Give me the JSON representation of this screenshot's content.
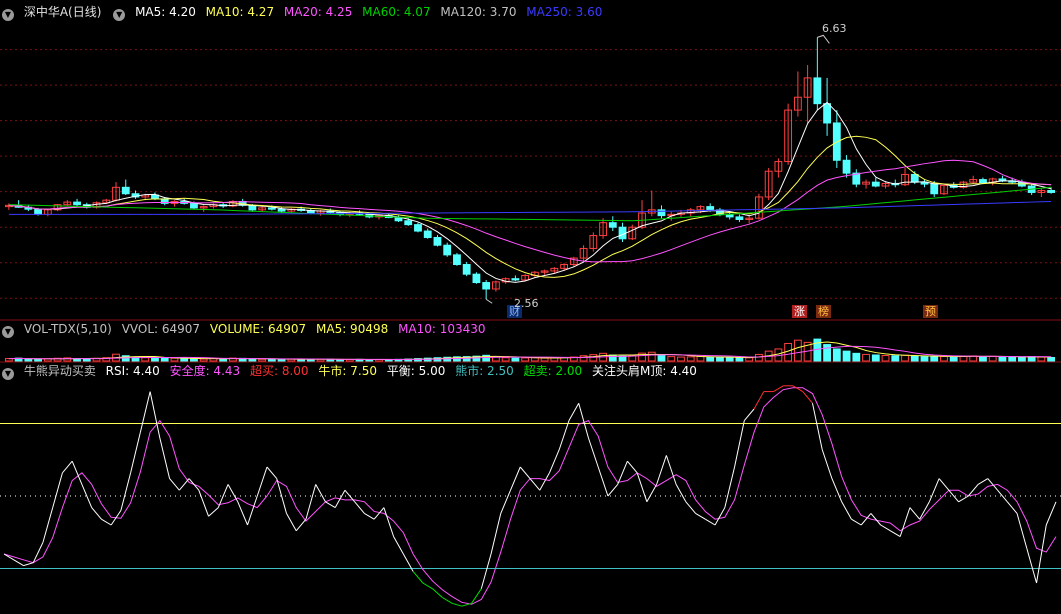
{
  "colors": {
    "bg": "#000000",
    "up": "#ff4040",
    "down": "#54ffff",
    "grid": "#7a1010",
    "ma5": "#ffffff",
    "ma10": "#ffff54",
    "ma20": "#ff54ff",
    "ma60": "#00d000",
    "ma120": "#a0a0a0",
    "ma250": "#3a3aff"
  },
  "price_panel": {
    "stock_name": "深中华A(日线)",
    "ma_labels": [
      {
        "text": "MA5: 4.20",
        "color": "#ffffff"
      },
      {
        "text": "MA10: 4.27",
        "color": "#ffff54"
      },
      {
        "text": "MA20: 4.25",
        "color": "#ff54ff"
      },
      {
        "text": "MA60: 4.07",
        "color": "#00d000"
      },
      {
        "text": "MA120: 3.70",
        "color": "#c0c0c0"
      },
      {
        "text": "MA250: 3.60",
        "color": "#3a3aff"
      }
    ],
    "high_label": "6.63",
    "low_label": "2.56",
    "markers": [
      {
        "text": "财",
        "color": "#8ab4ff",
        "bg": "#0a2a6a"
      },
      {
        "text": "涨",
        "color": "#ffffff",
        "bg": "#b02020"
      },
      {
        "text": "榜",
        "color": "#ffc040",
        "bg": "#7a2a10"
      },
      {
        "text": "预",
        "color": "#ffc040",
        "bg": "#7a2a10"
      }
    ]
  },
  "volume_panel": {
    "labels": [
      {
        "text": "VOL-TDX(5,10)",
        "color": "#c0c0c0"
      },
      {
        "text": "VVOL: 64907",
        "color": "#c0c0c0"
      },
      {
        "text": "VOLUME: 64907",
        "color": "#ffff54"
      },
      {
        "text": "MA5: 90498",
        "color": "#ffff54"
      },
      {
        "text": "MA10: 103430",
        "color": "#ff54ff"
      }
    ]
  },
  "rsi_panel": {
    "labels": [
      {
        "text": "牛熊异动买卖",
        "color": "#c0c0c0"
      },
      {
        "text": "RSI: 4.40",
        "color": "#ffffff"
      },
      {
        "text": "安全度: 4.43",
        "color": "#ff54ff"
      },
      {
        "text": "超买: 8.00",
        "color": "#ff3030"
      },
      {
        "text": "牛市: 7.50",
        "color": "#ffff54"
      },
      {
        "text": "平衡: 5.00",
        "color": "#ffffff"
      },
      {
        "text": "熊市: 2.50",
        "color": "#40c0c0"
      },
      {
        "text": "超卖: 2.00",
        "color": "#00e000"
      },
      {
        "text": "关注头肩M顶: 4.40",
        "color": "#ffffff"
      }
    ]
  },
  "chart_data": [
    {
      "type": "candlestick",
      "ylim": [
        2.3,
        6.9
      ],
      "ohlc": [
        [
          4.0,
          4.05,
          3.95,
          4.02
        ],
        [
          4.02,
          4.1,
          3.98,
          3.99
        ],
        [
          3.99,
          4.03,
          3.93,
          3.96
        ],
        [
          3.96,
          3.98,
          3.86,
          3.88
        ],
        [
          3.88,
          3.97,
          3.85,
          3.95
        ],
        [
          3.95,
          4.04,
          3.93,
          4.03
        ],
        [
          4.03,
          4.1,
          4.0,
          4.07
        ],
        [
          4.07,
          4.12,
          4.01,
          4.03
        ],
        [
          4.03,
          4.06,
          3.97,
          3.99
        ],
        [
          3.99,
          4.08,
          3.97,
          4.06
        ],
        [
          4.06,
          4.12,
          4.04,
          4.1
        ],
        [
          4.1,
          4.38,
          4.08,
          4.3
        ],
        [
          4.3,
          4.42,
          4.18,
          4.2
        ],
        [
          4.2,
          4.25,
          4.12,
          4.15
        ],
        [
          4.15,
          4.2,
          4.1,
          4.18
        ],
        [
          4.18,
          4.22,
          4.1,
          4.12
        ],
        [
          4.12,
          4.15,
          4.02,
          4.05
        ],
        [
          4.05,
          4.1,
          4.0,
          4.08
        ],
        [
          4.08,
          4.12,
          4.03,
          4.05
        ],
        [
          4.05,
          4.08,
          3.96,
          3.98
        ],
        [
          3.98,
          4.02,
          3.92,
          4.0
        ],
        [
          4.0,
          4.05,
          3.97,
          4.03
        ],
        [
          4.03,
          4.06,
          3.98,
          4.01
        ],
        [
          4.01,
          4.1,
          3.99,
          4.08
        ],
        [
          4.08,
          4.12,
          4.0,
          4.02
        ],
        [
          4.02,
          4.04,
          3.92,
          3.95
        ],
        [
          3.95,
          4.0,
          3.92,
          3.98
        ],
        [
          3.98,
          4.02,
          3.94,
          3.96
        ],
        [
          3.96,
          3.99,
          3.9,
          3.93
        ],
        [
          3.93,
          3.98,
          3.9,
          3.96
        ],
        [
          3.96,
          4.0,
          3.92,
          3.94
        ],
        [
          3.94,
          3.97,
          3.88,
          3.9
        ],
        [
          3.9,
          3.95,
          3.86,
          3.93
        ],
        [
          3.93,
          3.97,
          3.89,
          3.91
        ],
        [
          3.91,
          3.94,
          3.85,
          3.88
        ],
        [
          3.88,
          3.92,
          3.84,
          3.9
        ],
        [
          3.9,
          3.94,
          3.86,
          3.88
        ],
        [
          3.88,
          3.91,
          3.82,
          3.84
        ],
        [
          3.84,
          3.88,
          3.8,
          3.86
        ],
        [
          3.86,
          3.9,
          3.82,
          3.83
        ],
        [
          3.83,
          3.86,
          3.76,
          3.78
        ],
        [
          3.78,
          3.82,
          3.7,
          3.72
        ],
        [
          3.72,
          3.75,
          3.6,
          3.62
        ],
        [
          3.62,
          3.66,
          3.5,
          3.52
        ],
        [
          3.52,
          3.56,
          3.38,
          3.4
        ],
        [
          3.4,
          3.44,
          3.22,
          3.25
        ],
        [
          3.25,
          3.28,
          3.08,
          3.1
        ],
        [
          3.1,
          3.14,
          2.92,
          2.95
        ],
        [
          2.95,
          2.98,
          2.8,
          2.82
        ],
        [
          2.82,
          2.86,
          2.56,
          2.72
        ],
        [
          2.72,
          2.85,
          2.68,
          2.83
        ],
        [
          2.83,
          2.9,
          2.8,
          2.88
        ],
        [
          2.88,
          2.93,
          2.84,
          2.86
        ],
        [
          2.86,
          2.95,
          2.85,
          2.93
        ],
        [
          2.93,
          3.0,
          2.9,
          2.98
        ],
        [
          2.98,
          3.02,
          2.94,
          3.0
        ],
        [
          3.0,
          3.06,
          2.96,
          3.04
        ],
        [
          3.04,
          3.12,
          3.0,
          3.1
        ],
        [
          3.1,
          3.22,
          3.06,
          3.2
        ],
        [
          3.2,
          3.4,
          3.15,
          3.35
        ],
        [
          3.35,
          3.6,
          3.3,
          3.55
        ],
        [
          3.55,
          3.82,
          3.5,
          3.75
        ],
        [
          3.75,
          3.85,
          3.62,
          3.68
        ],
        [
          3.68,
          3.75,
          3.45,
          3.5
        ],
        [
          3.5,
          3.72,
          3.48,
          3.68
        ],
        [
          3.68,
          4.1,
          3.65,
          3.9
        ],
        [
          3.9,
          4.25,
          3.85,
          3.95
        ],
        [
          3.95,
          4.02,
          3.82,
          3.86
        ],
        [
          3.86,
          3.92,
          3.78,
          3.88
        ],
        [
          3.88,
          3.95,
          3.84,
          3.9
        ],
        [
          3.9,
          3.98,
          3.85,
          3.95
        ],
        [
          3.95,
          4.02,
          3.9,
          4.0
        ],
        [
          4.0,
          4.05,
          3.92,
          3.95
        ],
        [
          3.95,
          3.98,
          3.85,
          3.88
        ],
        [
          3.88,
          3.92,
          3.8,
          3.84
        ],
        [
          3.84,
          3.88,
          3.76,
          3.8
        ],
        [
          3.8,
          3.86,
          3.74,
          3.82
        ],
        [
          3.82,
          4.2,
          3.8,
          4.15
        ],
        [
          4.15,
          4.6,
          4.1,
          4.55
        ],
        [
          4.55,
          4.75,
          4.45,
          4.7
        ],
        [
          4.7,
          5.6,
          4.65,
          5.5
        ],
        [
          5.5,
          6.1,
          5.4,
          5.7
        ],
        [
          5.7,
          6.2,
          5.3,
          6.0
        ],
        [
          6.0,
          6.63,
          5.5,
          5.6
        ],
        [
          5.6,
          6.0,
          5.1,
          5.3
        ],
        [
          5.3,
          5.5,
          4.6,
          4.72
        ],
        [
          4.72,
          4.8,
          4.45,
          4.52
        ],
        [
          4.52,
          4.58,
          4.3,
          4.35
        ],
        [
          4.35,
          4.42,
          4.28,
          4.38
        ],
        [
          4.38,
          4.45,
          4.3,
          4.32
        ],
        [
          4.32,
          4.4,
          4.28,
          4.36
        ],
        [
          4.36,
          4.42,
          4.3,
          4.34
        ],
        [
          4.34,
          4.6,
          4.32,
          4.5
        ],
        [
          4.5,
          4.55,
          4.35,
          4.38
        ],
        [
          4.38,
          4.42,
          4.3,
          4.35
        ],
        [
          4.35,
          4.4,
          4.15,
          4.2
        ],
        [
          4.2,
          4.36,
          4.18,
          4.33
        ],
        [
          4.33,
          4.38,
          4.28,
          4.3
        ],
        [
          4.3,
          4.4,
          4.28,
          4.38
        ],
        [
          4.38,
          4.48,
          4.35,
          4.42
        ],
        [
          4.42,
          4.45,
          4.35,
          4.37
        ],
        [
          4.37,
          4.45,
          4.33,
          4.43
        ],
        [
          4.43,
          4.48,
          4.38,
          4.4
        ],
        [
          4.4,
          4.45,
          4.35,
          4.38
        ],
        [
          4.38,
          4.42,
          4.3,
          4.32
        ],
        [
          4.32,
          4.36,
          4.18,
          4.22
        ],
        [
          4.22,
          4.28,
          4.15,
          4.25
        ],
        [
          4.25,
          4.3,
          4.2,
          4.22
        ]
      ],
      "ma_series": [
        {
          "name": "MA5",
          "color": "#ffffff",
          "period": 5
        },
        {
          "name": "MA10",
          "color": "#ffff54",
          "period": 10
        },
        {
          "name": "MA20",
          "color": "#ff54ff",
          "period": 20
        },
        {
          "name": "MA60",
          "color": "#00d000",
          "base": [
            4.03,
            3.95,
            3.82,
            3.78,
            4.0,
            4.3
          ]
        },
        {
          "name": "MA250",
          "color": "#3a3aff",
          "base": [
            3.88,
            3.88,
            3.9,
            3.92,
            3.98,
            4.08
          ]
        }
      ]
    },
    {
      "type": "bar",
      "volumes": [
        22,
        26,
        18,
        14,
        20,
        25,
        28,
        22,
        18,
        24,
        30,
        62,
        48,
        35,
        30,
        28,
        24,
        26,
        22,
        20,
        18,
        22,
        20,
        26,
        24,
        18,
        16,
        18,
        15,
        17,
        16,
        14,
        16,
        15,
        13,
        14,
        15,
        13,
        14,
        13,
        15,
        18,
        22,
        26,
        30,
        34,
        38,
        40,
        44,
        52,
        36,
        30,
        26,
        28,
        30,
        26,
        28,
        32,
        36,
        48,
        58,
        70,
        54,
        44,
        50,
        72,
        80,
        52,
        40,
        36,
        38,
        42,
        36,
        32,
        30,
        28,
        30,
        60,
        90,
        110,
        160,
        190,
        170,
        200,
        150,
        110,
        90,
        70,
        60,
        55,
        50,
        48,
        52,
        45,
        40,
        38,
        42,
        40,
        44,
        46,
        40,
        42,
        38,
        36,
        34,
        40,
        36,
        32
      ],
      "ylim": [
        0,
        210
      ]
    },
    {
      "type": "line",
      "ylim": [
        1.0,
        9.0
      ],
      "levels": [
        {
          "value": 7.5,
          "color": "#ffff54",
          "style": "solid"
        },
        {
          "value": 5.0,
          "color": "#ffffff",
          "style": "dotted"
        },
        {
          "value": 2.5,
          "color": "#40c0c0",
          "style": "solid"
        }
      ],
      "rsi": [
        3.0,
        2.8,
        2.6,
        2.7,
        3.4,
        4.6,
        5.8,
        6.2,
        5.4,
        4.6,
        4.2,
        4.0,
        4.5,
        5.8,
        7.2,
        8.6,
        7.0,
        5.6,
        5.2,
        5.6,
        5.2,
        4.3,
        4.6,
        5.4,
        4.8,
        4.0,
        5.0,
        6.0,
        5.6,
        4.4,
        3.8,
        4.2,
        5.4,
        4.8,
        4.6,
        5.2,
        4.8,
        4.4,
        4.2,
        4.6,
        3.6,
        3.0,
        2.4,
        2.0,
        1.8,
        1.5,
        1.3,
        1.2,
        1.3,
        1.8,
        3.0,
        4.4,
        5.2,
        6.0,
        5.6,
        5.2,
        5.8,
        6.6,
        7.6,
        8.2,
        7.0,
        6.0,
        5.0,
        5.4,
        6.2,
        5.8,
        4.8,
        5.4,
        6.4,
        5.4,
        4.8,
        4.4,
        4.2,
        4.0,
        4.6,
        6.0,
        7.6,
        8.0,
        8.6,
        8.6,
        8.8,
        8.8,
        8.6,
        8.2,
        6.6,
        5.6,
        4.8,
        4.2,
        4.0,
        4.4,
        4.0,
        3.8,
        3.6,
        4.6,
        4.2,
        4.8,
        5.6,
        5.2,
        4.8,
        5.0,
        5.4,
        5.6,
        5.2,
        4.8,
        4.4,
        3.2,
        2.0,
        4.0,
        4.8
      ]
    }
  ]
}
